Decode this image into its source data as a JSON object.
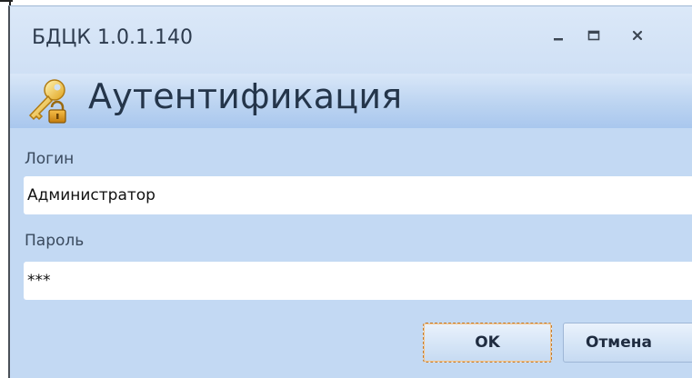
{
  "window": {
    "title": "БДЦК 1.0.1.140",
    "controls": {
      "minimize": "minimize-icon",
      "maximize": "maximize-icon",
      "close": "close-icon"
    }
  },
  "header": {
    "icon": "key-lock-icon",
    "title": "Аутентификация"
  },
  "form": {
    "login_label": "Логин",
    "login_value": "Администратор",
    "password_label": "Пароль",
    "password_value": "***"
  },
  "buttons": {
    "ok_label": "OK",
    "cancel_label": "Отмена"
  },
  "colors": {
    "window_bg": "#c3d9f3",
    "header_band": "#bcd4f1",
    "ok_focus_border": "#c37a2b"
  }
}
